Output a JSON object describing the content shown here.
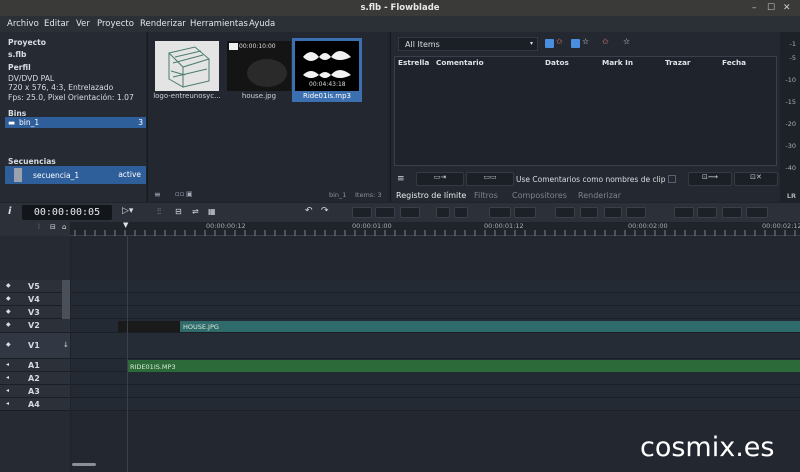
{
  "window": {
    "title": "s.flb - Flowblade"
  },
  "menu": [
    "Archivo",
    "Editar",
    "Ver",
    "Proyecto",
    "Renderizar",
    "Herramientas",
    "Ayuda"
  ],
  "project": {
    "heading": "Proyecto",
    "name": "s.flb",
    "profile_heading": "Perfil",
    "profile_name": "DV/DVD PAL",
    "profile_res": "720 x 576, 4:3, Entrelazado",
    "profile_fps": "Fps: 25.0, Pixel Orientación: 1.07",
    "bins_heading": "Bins",
    "bin_name": "bin_1",
    "bin_count": "3",
    "sequences_heading": "Secuencias",
    "sequence_name": "secuencia_1",
    "sequence_status": "active"
  },
  "media": {
    "items": [
      {
        "label": "logo-entreunosyc...",
        "duration": ""
      },
      {
        "label": "house.jpg",
        "duration": "00:00:10:00"
      },
      {
        "label": "Ride01is.mp3",
        "duration": "00:04:43:18"
      }
    ],
    "bin_label": "bin_1",
    "items_label": "Items: 3"
  },
  "logs": {
    "filter_selected": "All Items",
    "columns": [
      "Estrella",
      "Comentario",
      "Datos",
      "Mark In",
      "Trazar",
      "Fecha"
    ],
    "use_comments_label": "Use Comentarios como nombres de clip"
  },
  "meter": {
    "labels": [
      "-1",
      "-5",
      "-10",
      "-15",
      "-20",
      "-30",
      "-40",
      "LR"
    ]
  },
  "tabs": [
    "Registro de límite",
    "Filtros",
    "Compositores",
    "Renderizar"
  ],
  "timeline": {
    "timecode": "00:00:00:05",
    "ruler_labels": [
      "00:00:00:12",
      "00:00:01:00",
      "00:00:01:12",
      "00:00:02:00",
      "00:00:02:12"
    ],
    "tracks": [
      "V5",
      "V4",
      "V3",
      "V2",
      "V1",
      "A1",
      "A2",
      "A3",
      "A4"
    ],
    "video_clip": "HOUSE.JPG",
    "audio_clip": "RIDE01IS.MP3"
  },
  "watermark": "cosmix.es",
  "colors": {
    "selection": "#2f5f9a",
    "video_clip": "#2f6b6b",
    "audio_clip": "#2d6a3a"
  }
}
